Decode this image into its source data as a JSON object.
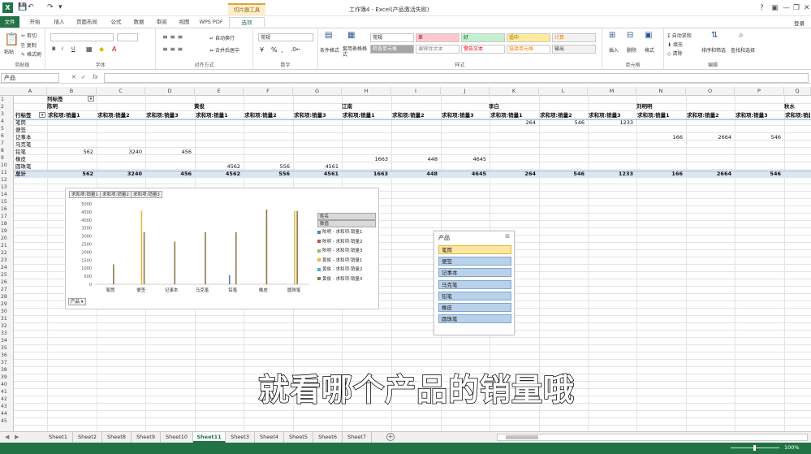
{
  "app": {
    "title": "工作簿4 - Excel(产品激活失败)",
    "context_group": "切片器工具",
    "login": "登录"
  },
  "qat": {
    "save": "💾",
    "undo": "↶",
    "redo": "↷",
    "more": "▾"
  },
  "window_controls": {
    "help": "?",
    "ribbon_opts": "▣",
    "minimize": "—",
    "restore": "❐",
    "close": "✕"
  },
  "tabs": [
    "文件",
    "开始",
    "插入",
    "页面布局",
    "公式",
    "数据",
    "审阅",
    "视图",
    "WPS PDF",
    "选项"
  ],
  "ribbon": {
    "clipboard": {
      "label": "剪贴板",
      "paste": "粘贴",
      "cut": "剪切",
      "copy": "复制",
      "format_painter": "格式刷"
    },
    "font": {
      "label": "字体",
      "bold": "B",
      "italic": "I",
      "underline": "U",
      "font_name": "",
      "font_size": ""
    },
    "alignment": {
      "label": "对齐方式",
      "wrap": "自动换行",
      "merge": "合并后居中"
    },
    "number": {
      "label": "数字",
      "format": "常规",
      "percent": "%",
      "comma": ","
    },
    "styles": {
      "label": "样式",
      "conditional": "条件格式",
      "table": "套用表格格式",
      "cells": [
        "常规",
        "差",
        "好",
        "适中",
        "计算",
        "检查单元格",
        "解释性文本",
        "警告文本",
        "链接单元格",
        "输出"
      ]
    },
    "cells": {
      "label": "单元格",
      "insert": "插入",
      "delete": "删除",
      "format": "格式"
    },
    "editing": {
      "label": "编辑",
      "autosum": "自动求和",
      "fill": "填充",
      "clear": "清除",
      "sort": "排序和筛选",
      "find": "查找和选择"
    }
  },
  "formula_bar": {
    "name_box": "产品",
    "fx": "fx",
    "cancel": "✕",
    "enter": "✓"
  },
  "columns": [
    "A",
    "B",
    "C",
    "D",
    "E",
    "F",
    "G",
    "H",
    "I",
    "J",
    "K",
    "L",
    "M",
    "N",
    "O",
    "P",
    "Q"
  ],
  "rows": [
    "1",
    "2",
    "3",
    "4",
    "5",
    "6",
    "7",
    "8",
    "9",
    "10",
    "11",
    "12",
    "13",
    "14",
    "15",
    "16",
    "17",
    "18",
    "19",
    "20",
    "21",
    "22",
    "23",
    "24",
    "25",
    "26",
    "27",
    "28",
    "29",
    "30",
    "31",
    "32",
    "33",
    "34",
    "35",
    "36",
    "37",
    "38",
    "39",
    "40",
    "41",
    "42",
    "43",
    "44",
    "45"
  ],
  "pivot": {
    "col_label": "列标签",
    "row_label": "行标签",
    "total": "总计",
    "people": [
      "陈明",
      "黄俊",
      "江南",
      "李白",
      "刘明明",
      "秋水"
    ],
    "measures": [
      "求和项:销量1",
      "求和项:销量2",
      "求和项:销量3",
      "求和项:销量1",
      "求和项:销量2",
      "求和项:销量3",
      "求和项:销量1",
      "求和项:销量2",
      "求和项:销量3",
      "求和项:销量1",
      "求和项:销量2",
      "求和项:销量3",
      "求和项:销量1",
      "求和项:销量2",
      "求和项:销量3",
      "求和项:销量1"
    ],
    "products": [
      "笔筒",
      "便签",
      "记事本",
      "马克笔",
      "铅笔",
      "橡皮",
      "圆珠笔"
    ],
    "values": {
      "r4": [
        "",
        "",
        "",
        "",
        "",
        "",
        "",
        "",
        "",
        "264",
        "546",
        "1233",
        "",
        "",
        ""
      ],
      "r6": [
        "",
        "",
        "",
        "",
        "",
        "",
        "",
        "",
        "",
        "",
        "",
        "",
        "166",
        "2664",
        "546"
      ],
      "r8": [
        "562",
        "3240",
        "456",
        "",
        "",
        "",
        "",
        "",
        "",
        "",
        "",
        "",
        "",
        "",
        ""
      ],
      "r9": [
        "",
        "",
        "",
        "",
        "",
        "",
        "1663",
        "448",
        "4645",
        "",
        "",
        "",
        "",
        "",
        ""
      ],
      "r10": [
        "",
        "",
        "",
        "4562",
        "556",
        "4561",
        "",
        "",
        "",
        "",
        "",
        "",
        "",
        "",
        ""
      ],
      "r11": [
        "562",
        "3240",
        "456",
        "4562",
        "556",
        "4561",
        "1663",
        "448",
        "4645",
        "264",
        "546",
        "1233",
        "166",
        "2664",
        "546"
      ]
    }
  },
  "chart_data": {
    "type": "bar",
    "title": "",
    "field_buttons": [
      "求和项:销量1",
      "求和项:销量2",
      "求和项:销量3"
    ],
    "legend_field_buttons": [
      "姓名",
      "数值"
    ],
    "axis_field_button": "产品",
    "categories": [
      "笔筒",
      "便签",
      "记事本",
      "马克笔",
      "铅笔",
      "橡皮",
      "圆珠笔"
    ],
    "ylim": [
      0,
      5000
    ],
    "yticks": [
      "5000",
      "4500",
      "4000",
      "3500",
      "3000",
      "2500",
      "2000",
      "1500",
      "1000",
      "500",
      "0"
    ],
    "series": [
      {
        "name": "陈明 - 求和项:销量1",
        "color": "#4f81bd",
        "values": [
          0,
          0,
          0,
          0,
          562,
          0,
          0
        ]
      },
      {
        "name": "陈明 - 求和项:销量2",
        "color": "#c0504d",
        "values": [
          0,
          0,
          0,
          0,
          0,
          0,
          0
        ]
      },
      {
        "name": "陈明 - 求和项:销量3",
        "color": "#9bbb59",
        "values": [
          0,
          0,
          0,
          0,
          0,
          0,
          0
        ]
      },
      {
        "name": "黄俊 - 求和项:销量1",
        "color": "#e6b83f",
        "values": [
          0,
          4562,
          0,
          0,
          0,
          0,
          4562
        ]
      },
      {
        "name": "黄俊 - 求和项:销量2",
        "color": "#4bacc6",
        "values": [
          0,
          0,
          0,
          0,
          0,
          0,
          0
        ]
      },
      {
        "name": "黄俊 - 求和项:销量3",
        "color": "#8c7a4b",
        "values": [
          1233,
          3240,
          2664,
          3240,
          3240,
          4645,
          4561
        ]
      }
    ]
  },
  "slicer": {
    "title": "产品",
    "clear_icon": "⊠",
    "items": [
      "笔筒",
      "便签",
      "记事本",
      "马克笔",
      "铅笔",
      "橡皮",
      "圆珠笔"
    ],
    "selected": "笔筒"
  },
  "subtitle": "就看哪个产品的销量哦",
  "sheets": [
    "Sheet1",
    "Sheet2",
    "Sheet8",
    "Sheet9",
    "Sheet10",
    "Sheet11",
    "Sheet3",
    "Sheet4",
    "Sheet5",
    "Sheet6",
    "Sheet7"
  ],
  "active_sheet": "Sheet11",
  "status": {
    "zoom": "100%"
  }
}
